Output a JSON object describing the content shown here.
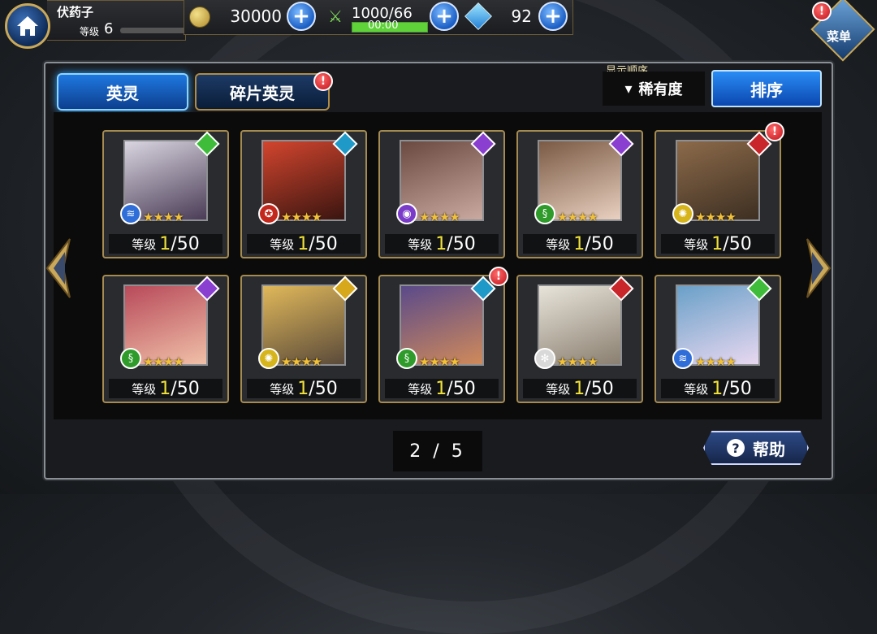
{
  "player": {
    "name": "伏药子",
    "level_label": "等级",
    "level": "6"
  },
  "resources": {
    "gold": "30000",
    "stamina": "1000/66",
    "stamina_timer": "00:00",
    "gems": "92"
  },
  "menu": {
    "label": "菜单"
  },
  "tabs": [
    {
      "label": "英灵",
      "active": true
    },
    {
      "label": "碎片英灵",
      "active": false
    }
  ],
  "sort": {
    "label": "显示顺序",
    "value": "稀有度",
    "button": "排序"
  },
  "cards": [
    {
      "level_label": "等级",
      "level": "1",
      "max": "/50",
      "element": "green",
      "class_color": "#2f6ed8",
      "class_glyph": "≋",
      "alert": false
    },
    {
      "level_label": "等级",
      "level": "1",
      "max": "/50",
      "element": "teal",
      "class_color": "#c4281c",
      "class_glyph": "✪",
      "alert": false
    },
    {
      "level_label": "等级",
      "level": "1",
      "max": "/50",
      "element": "purple",
      "class_color": "#7a3bc8",
      "class_glyph": "◉",
      "alert": false
    },
    {
      "level_label": "等级",
      "level": "1",
      "max": "/50",
      "element": "purple",
      "class_color": "#2e9b2a",
      "class_glyph": "§",
      "alert": false
    },
    {
      "level_label": "等级",
      "level": "1",
      "max": "/50",
      "element": "red",
      "class_color": "#d6b41c",
      "class_glyph": "✺",
      "alert": true
    },
    {
      "level_label": "等级",
      "level": "1",
      "max": "/50",
      "element": "purple",
      "class_color": "#2e9b2a",
      "class_glyph": "§",
      "alert": false
    },
    {
      "level_label": "等级",
      "level": "1",
      "max": "/50",
      "element": "yellow",
      "class_color": "#d6b41c",
      "class_glyph": "✺",
      "alert": false
    },
    {
      "level_label": "等级",
      "level": "1",
      "max": "/50",
      "element": "teal",
      "class_color": "#2e9b2a",
      "class_glyph": "§",
      "alert": true
    },
    {
      "level_label": "等级",
      "level": "1",
      "max": "/50",
      "element": "red",
      "class_color": "#d9d9d9",
      "class_glyph": "✻",
      "alert": false
    },
    {
      "level_label": "等级",
      "level": "1",
      "max": "/50",
      "element": "green",
      "class_color": "#2f6ed8",
      "class_glyph": "≋",
      "alert": false
    }
  ],
  "stars": "★★★★",
  "pagination": {
    "current": "2",
    "total": "5",
    "text": "2 / 5"
  },
  "help": {
    "label": "帮助"
  },
  "colors": {
    "accent": "#1e78e0",
    "gold_border": "#a58b50",
    "level_yellow": "#f0e23a"
  }
}
